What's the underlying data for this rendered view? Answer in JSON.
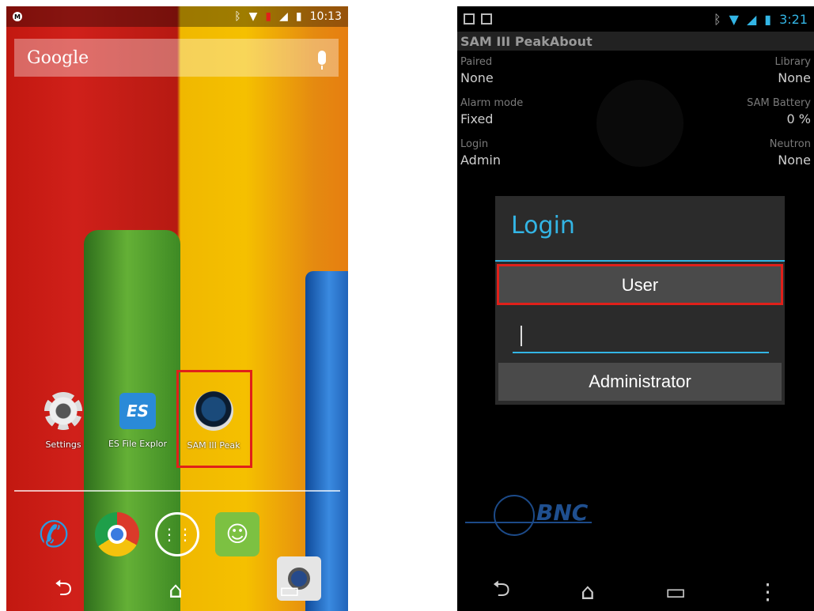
{
  "left_phone": {
    "status": {
      "time": "10:13"
    },
    "search": {
      "brand": "Google"
    },
    "apps": [
      {
        "label": "Settings"
      },
      {
        "label": "ES File Explor"
      },
      {
        "label": "SAM III Peak"
      }
    ],
    "dock": [
      "phone",
      "chrome",
      "apps",
      "messaging",
      "camera"
    ],
    "nav": {
      "back": "⮌",
      "home": "⌂",
      "recents": "▭"
    }
  },
  "right_phone": {
    "status": {
      "time": "3:21"
    },
    "action_bar": {
      "title": "SAM III PeakAbout"
    },
    "info": {
      "paired_label": "Paired",
      "paired_value": "None",
      "library_label": "Library",
      "library_value": "None",
      "alarm_label": "Alarm mode",
      "alarm_value": "Fixed",
      "battery_label": "SAM Battery",
      "battery_value": "0 %",
      "login_label": "Login",
      "login_value": "Admin",
      "neutron_label": "Neutron",
      "neutron_value": "None"
    },
    "dialog": {
      "title": "Login",
      "user_button": "User",
      "password_value": "",
      "admin_button": "Administrator"
    },
    "logo_text": "BNC",
    "nav": {
      "back": "⮌",
      "home": "⌂",
      "recents": "▭",
      "menu": "⋮"
    }
  },
  "colors": {
    "accent": "#33b5e5",
    "highlight": "#e0201a",
    "logo": "#1f4f8f"
  }
}
